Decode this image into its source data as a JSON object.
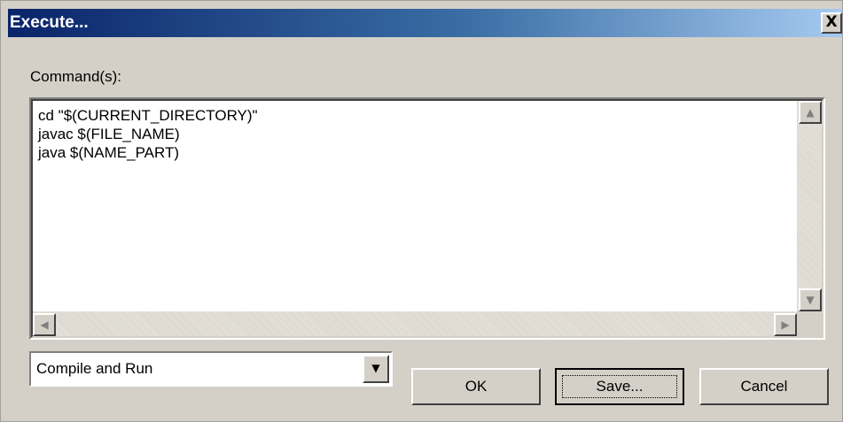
{
  "window": {
    "title": "Execute...",
    "close_glyph": "X"
  },
  "commands": {
    "label": "Command(s):",
    "lines": "cd \"$(CURRENT_DIRECTORY)\"\njavac $(FILE_NAME)\njava $(NAME_PART)"
  },
  "preset": {
    "selected": "Compile and Run"
  },
  "buttons": {
    "ok": "OK",
    "save": "Save...",
    "cancel": "Cancel"
  },
  "icons": {
    "close": "close-icon",
    "scroll_up": "scroll-up-arrow",
    "scroll_down": "scroll-down-arrow",
    "scroll_left": "scroll-left-arrow",
    "scroll_right": "scroll-right-arrow",
    "dropdown": "chevron-down-icon"
  },
  "colors": {
    "title_gradient_start": "#0a246a",
    "title_gradient_end": "#a6caf0",
    "dialog_face": "#d4d0c8"
  }
}
